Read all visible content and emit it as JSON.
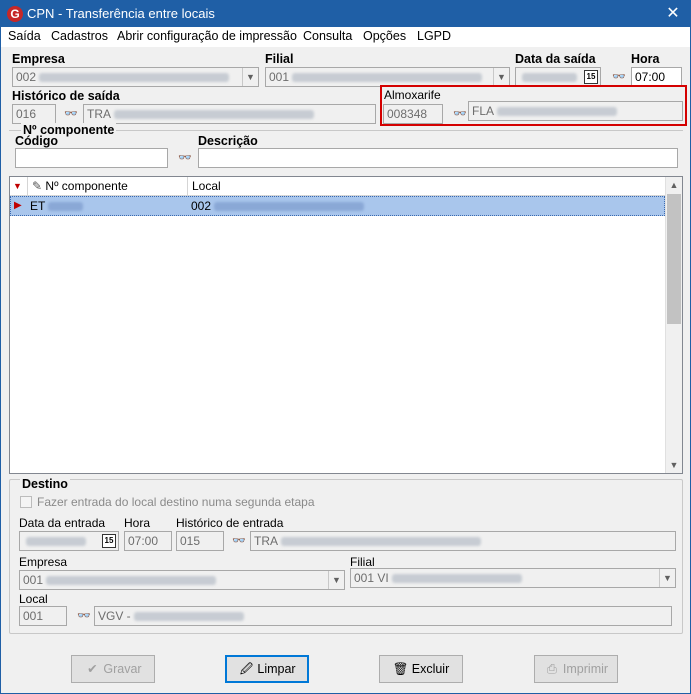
{
  "window": {
    "title": "CPN - Transferência entre locais",
    "close_glyph": "✕",
    "icon_letter": "G"
  },
  "menu": [
    "Saída",
    "Cadastros",
    "Abrir configuração de impressão",
    "Consulta",
    "Opções",
    "LGPD"
  ],
  "top": {
    "empresa_label": "Empresa",
    "empresa_value": "002",
    "filial_label": "Filial",
    "filial_value": "001",
    "data_saida_label": "Data da saída",
    "cal_glyph": "15",
    "hora_label": "Hora",
    "hora_value": "07:00",
    "historico_label": "Histórico de saída",
    "historico_code": "016",
    "historico_desc": "TRA",
    "almoxarife_label": "Almoxarife",
    "almoxarife_code": "008348",
    "almoxarife_name": "FLA"
  },
  "componente": {
    "group_label": "Nº componente",
    "codigo_label": "Código",
    "codigo_value": "",
    "descricao_label": "Descrição",
    "descricao_value": ""
  },
  "grid": {
    "columns": [
      "Nº componente",
      "Local"
    ],
    "rows": [
      {
        "componente": "ET",
        "local": "002"
      }
    ]
  },
  "destino": {
    "group_label": "Destino",
    "checkbox_label": "Fazer entrada do local destino numa segunda etapa",
    "data_entrada_label": "Data da entrada",
    "hora_label": "Hora",
    "hora_value": "07:00",
    "historico_entrada_label": "Histórico de entrada",
    "historico_code": "015",
    "historico_desc": "TRA",
    "empresa_label": "Empresa",
    "empresa_value": "001",
    "filial_label": "Filial",
    "filial_value": "001 VI",
    "local_label": "Local",
    "local_code": "001",
    "local_desc": "VGV -"
  },
  "buttons": {
    "gravar": "Gravar",
    "limpar": "Limpar",
    "excluir": "Excluir",
    "imprimir": "Imprimir"
  },
  "colors": {
    "titlebar": "#1f5fa6",
    "highlight": "#d40000",
    "selected_row": "#a9c6ec",
    "default_button_border": "#0078d7"
  }
}
